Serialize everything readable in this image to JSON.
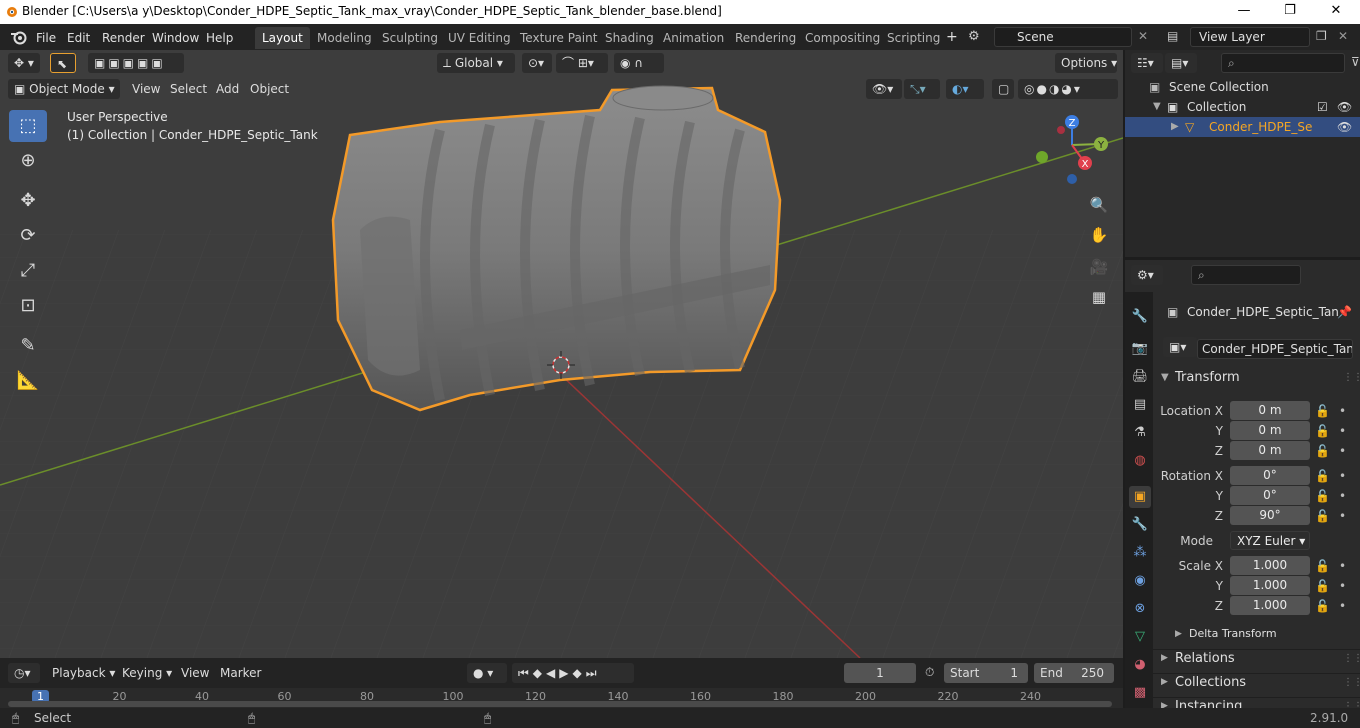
{
  "window": {
    "title": "Blender [C:\\Users\\a y\\Desktop\\Conder_HDPE_Septic_Tank_max_vray\\Conder_HDPE_Septic_Tank_blender_base.blend]",
    "minimize": "—",
    "maximize": "❐",
    "close": "✕"
  },
  "menu": [
    "File",
    "Edit",
    "Render",
    "Window",
    "Help"
  ],
  "workspaces": [
    "Layout",
    "Modeling",
    "Sculpting",
    "UV Editing",
    "Texture Paint",
    "Shading",
    "Animation",
    "Rendering",
    "Compositing",
    "Scripting"
  ],
  "active_workspace": "Layout",
  "scene": {
    "name": "Scene",
    "view_layer": "View Layer"
  },
  "viewport": {
    "transform_orientation": "Global",
    "options_label": "Options",
    "mode": "Object Mode",
    "menus": [
      "View",
      "Select",
      "Add",
      "Object"
    ],
    "perspective": "User Perspective",
    "collection_info": "(1) Collection | Conder_HDPE_Septic_Tank",
    "gizmo_labels": {
      "x": "X",
      "y": "Y",
      "z": "Z"
    }
  },
  "outliner": {
    "root": "Scene Collection",
    "collection": "Collection",
    "object": "Conder_HDPE_Septic"
  },
  "properties": {
    "object_name_header": "Conder_HDPE_Septic_Tan",
    "object_name_field": "Conder_HDPE_Septic_Tank",
    "transform_title": "Transform",
    "location_label": "Location X",
    "rotation_label": "Rotation X",
    "scale_label": "Scale X",
    "y_label": "Y",
    "z_label": "Z",
    "location": [
      "0 m",
      "0 m",
      "0 m"
    ],
    "rotation": [
      "0°",
      "0°",
      "90°"
    ],
    "mode_label": "Mode",
    "mode_value": "XYZ Euler",
    "scale": [
      "1.000",
      "1.000",
      "1.000"
    ],
    "delta_transform": "Delta Transform",
    "relations": "Relations",
    "collections": "Collections",
    "instancing": "Instancing"
  },
  "timeline": {
    "menus": [
      "Playback",
      "Keying",
      "View",
      "Marker"
    ],
    "current_frame": "1",
    "start_label": "Start",
    "start": "1",
    "end_label": "End",
    "end": "250",
    "ruler": [
      "1",
      "20",
      "40",
      "60",
      "80",
      "100",
      "120",
      "140",
      "160",
      "180",
      "200",
      "220",
      "240"
    ]
  },
  "status": {
    "left": "Select",
    "version": "2.91.0"
  }
}
